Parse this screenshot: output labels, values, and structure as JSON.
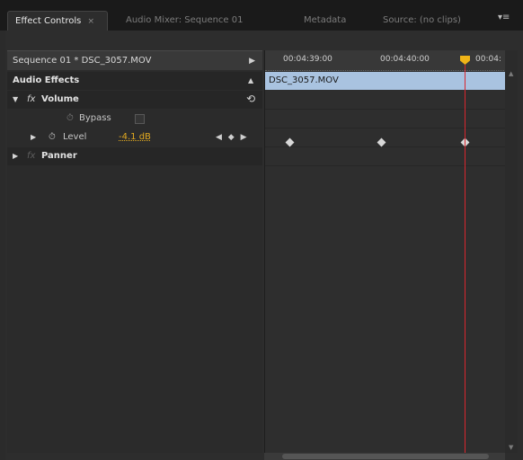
{
  "tabs": [
    {
      "label": "Effect Controls",
      "active": true,
      "close": "×"
    },
    {
      "label": "Audio Mixer: Sequence 01",
      "active": false
    },
    {
      "label": "Metadata",
      "active": false
    },
    {
      "label": "Source: (no clips)",
      "active": false
    }
  ],
  "tab_menu_glyph": "▾≡",
  "sequence_header": {
    "label": "Sequence 01 * DSC_3057.MOV",
    "arrow": "▶"
  },
  "sections": {
    "audio_effects": "Audio Effects",
    "volume": "Volume",
    "fx": "fx",
    "bypass": "Bypass",
    "level": "Level",
    "level_value": "-4.1 dB",
    "panner": "Panner"
  },
  "icons": {
    "stopwatch": "stopwatch-icon",
    "reset": "reset-icon",
    "prev_keyframe": "prev-keyframe-icon",
    "add_keyframe": "add-keyframe-icon",
    "next_keyframe": "next-keyframe-icon"
  },
  "glyphs": {
    "collapse_up": "▲",
    "tri_down": "▼",
    "tri_right": "▶",
    "stopwatch": "⏱",
    "reset": "⟲",
    "kf_nav": "◀ ◆ ▶"
  },
  "timeline": {
    "timecodes": [
      "00:04:39:00",
      "00:04:40:00",
      "00:04:"
    ],
    "clip_name": "DSC_3057.MOV",
    "playhead_color": "#d9262e",
    "playhead_handle_color": "#f0b417",
    "clip_color": "#a9c3e0"
  },
  "scroll": {
    "up": "▲",
    "down": "▼"
  }
}
